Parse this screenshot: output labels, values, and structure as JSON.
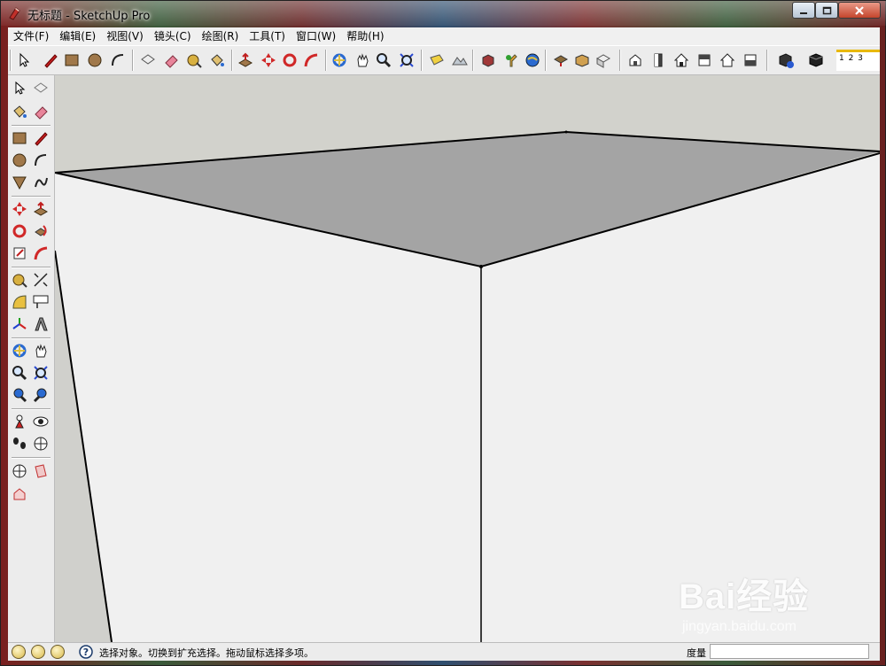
{
  "window": {
    "title": "无标题 - SketchUp Pro"
  },
  "menu": [
    "文件(F)",
    "编辑(E)",
    "视图(V)",
    "镜头(C)",
    "绘图(R)",
    "工具(T)",
    "窗口(W)",
    "帮助(H)"
  ],
  "toolbar": {
    "buttons": [
      "select-icon",
      "pencil-icon",
      "rectangle-icon",
      "circle-icon",
      "arc-icon",
      "make-component-icon",
      "eraser-icon",
      "tape-measure-icon",
      "paint-bucket-icon",
      "push-pull-icon",
      "move-icon",
      "rotate-icon",
      "follow-me-icon",
      "orbit-icon",
      "pan-icon",
      "zoom-icon",
      "zoom-extents-icon",
      "add-location-icon",
      "toggle-terrain-icon",
      "get-models-icon",
      "get-photo-texture-icon",
      "preview-in-earth-icon",
      "share-model-icon",
      "share-component-icon",
      "get-models-3dw-icon",
      "iso-view-icon",
      "front-view-icon",
      "top-view-icon",
      "right-view-icon",
      "back-view-icon",
      "left-view-icon",
      "components-icon",
      "solid-tools-icon"
    ],
    "scene_tabs": "1 2 3"
  },
  "left_tools": [
    "select-icon",
    "make-component-icon",
    "paint-bucket-icon",
    "eraser-icon",
    "rectangle-icon",
    "line-icon",
    "circle-icon",
    "arc-icon",
    "polygon-icon",
    "freehand-icon",
    "move-icon",
    "push-pull-icon",
    "rotate-icon",
    "follow-me-icon",
    "scale-icon",
    "offset-icon",
    "tape-measure-icon",
    "dimension-icon",
    "protractor-icon",
    "text-icon",
    "axes-icon",
    "3d-text-icon",
    "orbit-icon",
    "pan-icon",
    "zoom-icon",
    "zoom-window-icon",
    "previous-view-icon",
    "next-view-icon",
    "position-camera-icon",
    "look-around-icon",
    "walk-icon",
    "section-plane-icon",
    "sandbox-icon",
    "display-section-icon",
    "section-cuts-icon"
  ],
  "status": {
    "text": "选择对象。切换到扩充选择。拖动鼠标选择多项。",
    "measure_label": "度量",
    "measure_value": ""
  },
  "watermark": {
    "brand": "Bai经验",
    "url": "jingyan.baidu.com"
  },
  "colors": {
    "top_face": "#a4a4a4",
    "wall": "#f0f0f0",
    "sky": "#d2d2cc",
    "edge": "#000000"
  }
}
